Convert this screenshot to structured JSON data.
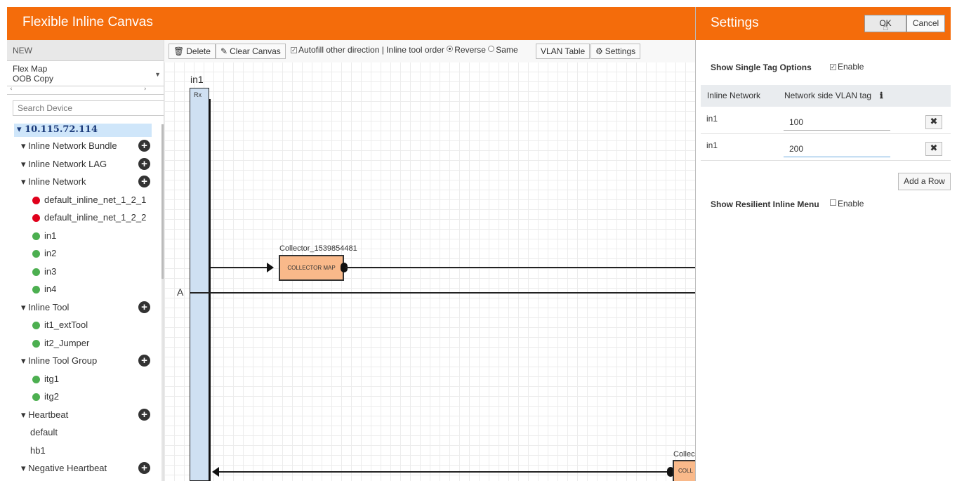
{
  "app": {
    "title": "Flexible Inline Canvas"
  },
  "left": {
    "new_label": "NEW",
    "map_list": [
      "Flex Map",
      "OOB Copy"
    ],
    "search_placeholder": "Search Device",
    "root": "10.115.72.114",
    "tree": [
      {
        "kind": "group",
        "label": "Inline Network Bundle",
        "plus": true
      },
      {
        "kind": "group",
        "label": "Inline Network LAG",
        "plus": true
      },
      {
        "kind": "group",
        "label": "Inline Network",
        "plus": true
      },
      {
        "kind": "leaf",
        "label": "default_inline_net_1_2_1",
        "status": "red"
      },
      {
        "kind": "leaf",
        "label": "default_inline_net_1_2_2",
        "status": "red"
      },
      {
        "kind": "leaf",
        "label": "in1",
        "status": "green"
      },
      {
        "kind": "leaf",
        "label": "in2",
        "status": "green"
      },
      {
        "kind": "leaf",
        "label": "in3",
        "status": "green"
      },
      {
        "kind": "leaf",
        "label": "in4",
        "status": "green"
      },
      {
        "kind": "group",
        "label": "Inline Tool",
        "plus": true
      },
      {
        "kind": "leaf",
        "label": "it1_extTool",
        "status": "green"
      },
      {
        "kind": "leaf",
        "label": "it2_Jumper",
        "status": "green"
      },
      {
        "kind": "group",
        "label": "Inline Tool Group",
        "plus": true
      },
      {
        "kind": "leaf",
        "label": "itg1",
        "status": "green"
      },
      {
        "kind": "leaf",
        "label": "itg2",
        "status": "green"
      },
      {
        "kind": "group",
        "label": "Heartbeat",
        "plus": true
      },
      {
        "kind": "plain",
        "label": "default"
      },
      {
        "kind": "plain",
        "label": "hb1"
      },
      {
        "kind": "group",
        "label": "Negative Heartbeat",
        "plus": true
      }
    ]
  },
  "toolbar": {
    "delete": "Delete",
    "clear": "Clear Canvas",
    "autofill": "Autofill other direction | Inline tool order",
    "reverse": "Reverse",
    "same": "Same",
    "vlan_table": "VLAN Table",
    "settings": "Settings"
  },
  "canvas": {
    "network_label": "in1",
    "rx_label": "Rx",
    "a_label": "A",
    "collector_name": "Collector_1539854481",
    "collector_box": "COLLECTOR MAP",
    "collector2_name": "Collec",
    "collector2_box": "COLL"
  },
  "settings": {
    "title": "Settings",
    "ok": "OK",
    "cancel": "Cancel",
    "single_tag_label": "Show Single Tag Options",
    "single_tag_enable": "Enable",
    "single_tag_checked": true,
    "table_headers": [
      "Inline Network",
      "Network side VLAN tag"
    ],
    "rows": [
      {
        "network": "in1",
        "tag": "100"
      },
      {
        "network": "in1",
        "tag": "200"
      }
    ],
    "add_row": "Add a Row",
    "resilient_label": "Show Resilient Inline Menu",
    "resilient_enable": "Enable",
    "resilient_checked": false
  },
  "colors": {
    "header": "#f46c0b",
    "collector": "#f9b98a",
    "rx_bar": "#cfe0f2",
    "selected": "#cfe6fa"
  }
}
